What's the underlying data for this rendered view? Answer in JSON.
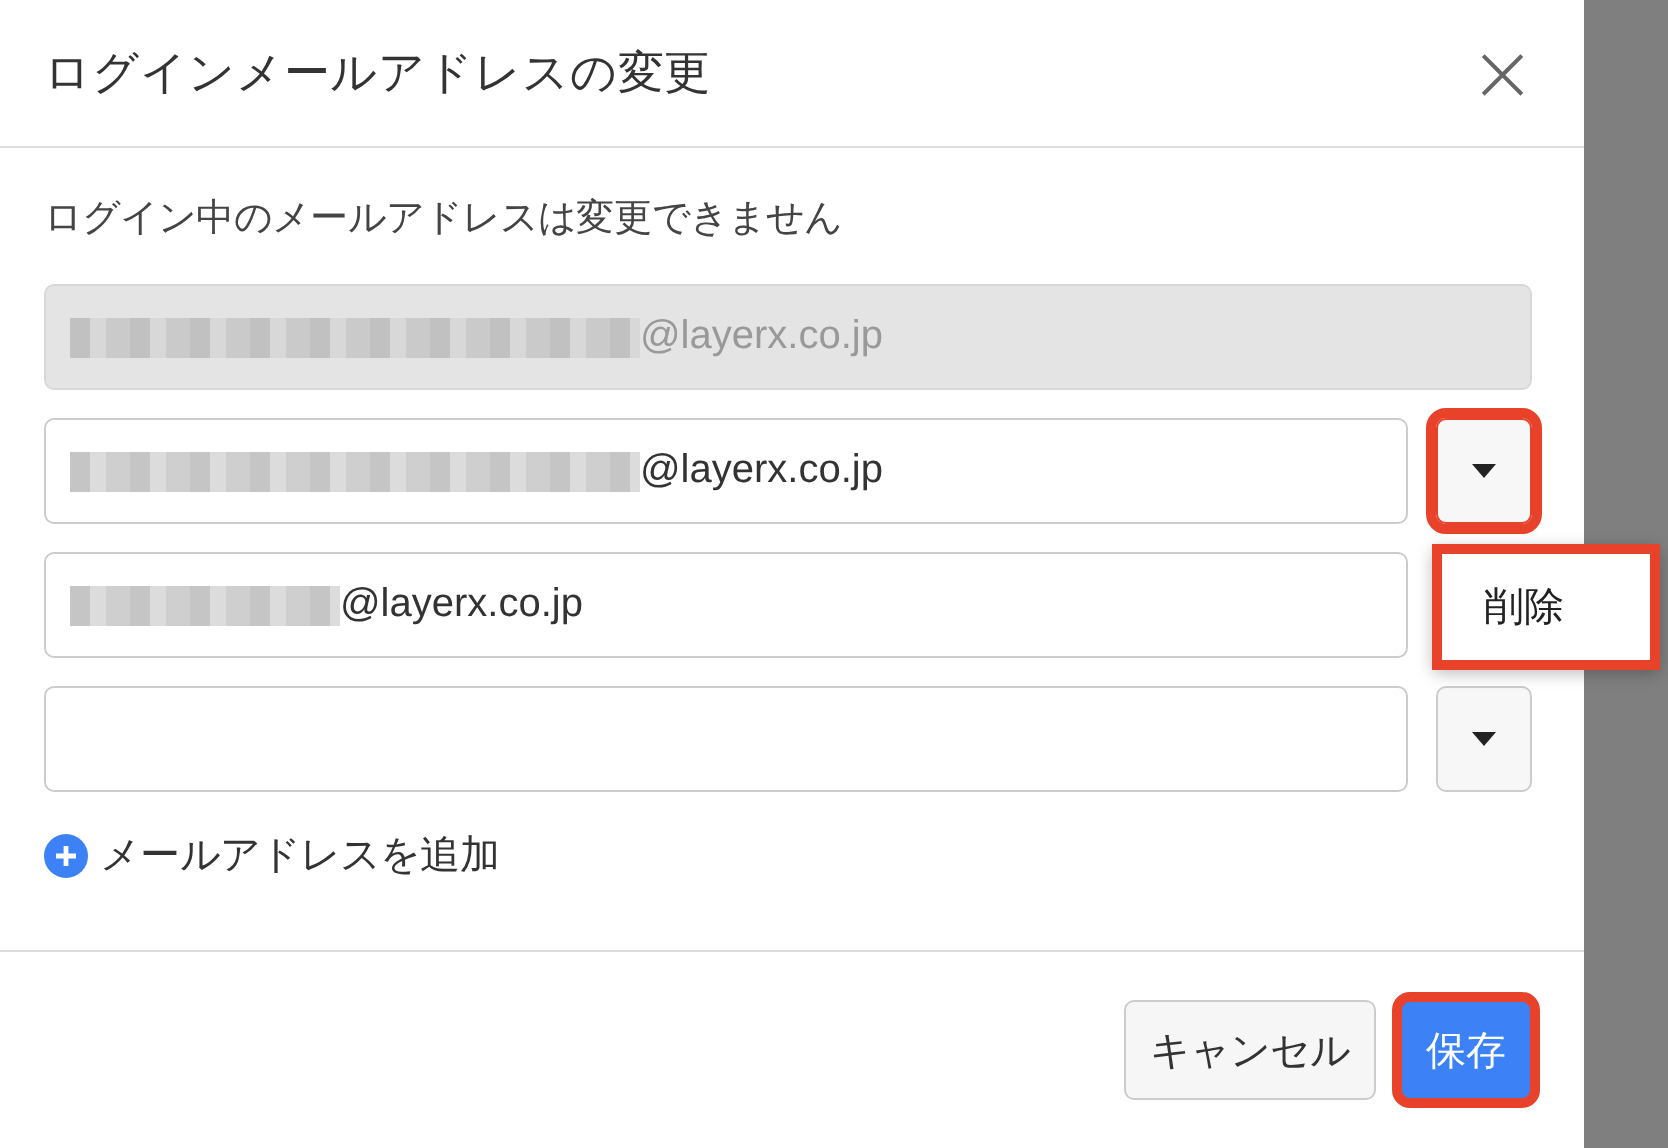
{
  "dialog": {
    "title": "ログインメールアドレスの変更",
    "close_symbol": "×"
  },
  "label": "ログイン中のメールアドレスは変更できません",
  "current_email": {
    "value": "@layerx.co.jp",
    "disabled": true,
    "redacted": true
  },
  "emails": [
    {
      "value": "@layerx.co.jp",
      "redacted": true,
      "dropdown": {
        "highlighted": true
      }
    },
    {
      "value": "@layerx.co.jp",
      "redacted": true
    },
    {
      "dropdown": {
        "highlighted": false
      }
    }
  ],
  "dropdown_menu": {
    "items": [
      {
        "label": "削除",
        "highlighted": true
      }
    ]
  },
  "add_link": {
    "label": "メールアドレスを追加"
  },
  "buttons": [
    {
      "label": "キャンセル",
      "kind": "secondary",
      "highlighted": false
    },
    {
      "label": "保存",
      "kind": "primary",
      "highlighted": true
    }
  ]
}
